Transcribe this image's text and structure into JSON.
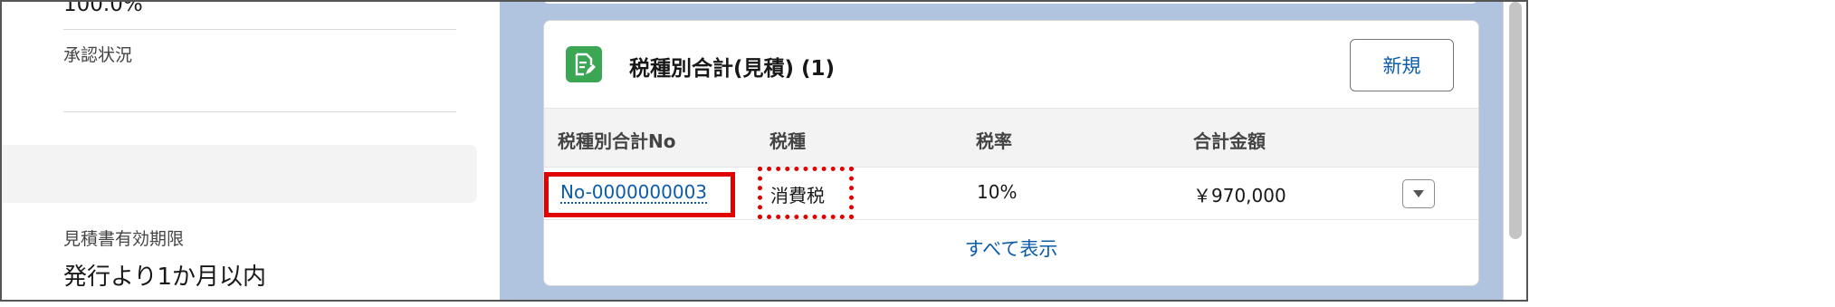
{
  "left_panel": {
    "percentage_value": "100.0%",
    "approval_status_label": "承認状況",
    "approval_status_value": "",
    "validity_label": "見積書有効期限",
    "validity_value": "発行より1か月以内"
  },
  "related_list": {
    "icon": "document-edit-icon",
    "title": "税種別合計(見積) (1)",
    "new_button_label": "新規",
    "columns": [
      "税種別合計No",
      "税種",
      "税率",
      "合計金額"
    ],
    "rows": [
      {
        "no": "No-0000000003",
        "tax_type": "消費税",
        "tax_rate": "10%",
        "total_amount": "￥970,000"
      }
    ],
    "view_all_label": "すべて表示"
  },
  "colors": {
    "brand_blue": "#0b5cab",
    "icon_green": "#3ba755",
    "highlight_red": "#e00000",
    "page_bg": "#b0c4df"
  }
}
